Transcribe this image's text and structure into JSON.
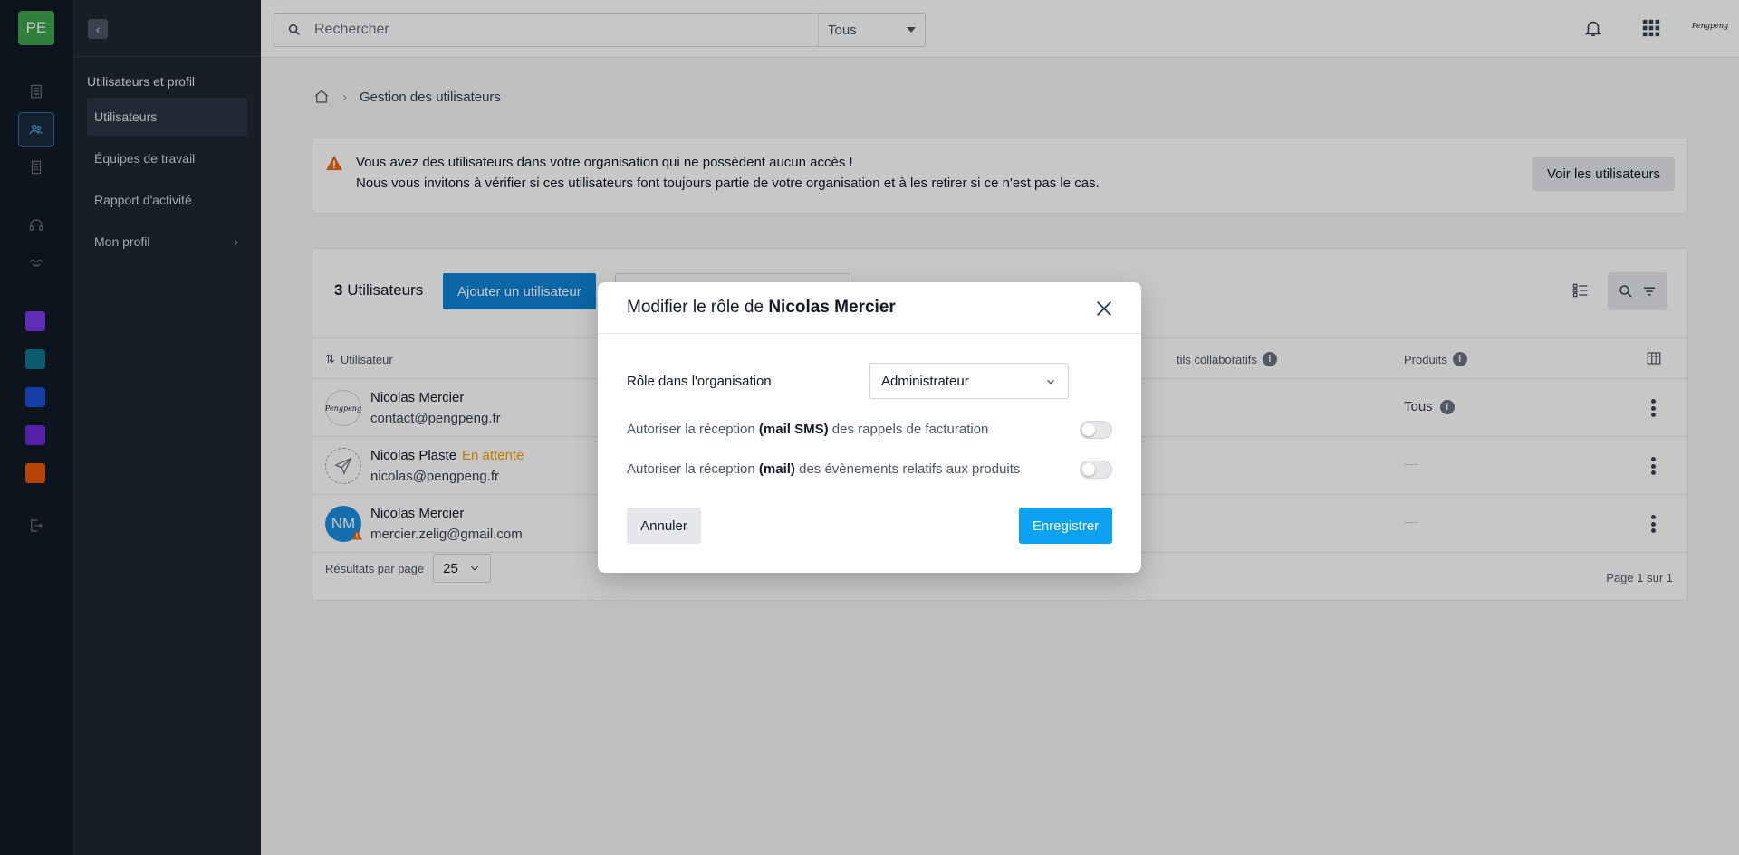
{
  "rail": {
    "avatar_initials": "PE",
    "icons": [
      "calculator-icon",
      "users-icon",
      "building-icon",
      "headset-icon",
      "handshake-icon"
    ],
    "apps": [
      {
        "name": "app-k-icon",
        "color": "#7c3aed"
      },
      {
        "name": "app-play-icon",
        "color": "#0e7490"
      },
      {
        "name": "app-cube-icon",
        "color": "#1d4ed8"
      },
      {
        "name": "app-square-icon",
        "color": "#6d28d9"
      },
      {
        "name": "app-doc-icon",
        "color": "#ea580c"
      }
    ],
    "logout_icon": "logout-icon"
  },
  "sidebar": {
    "section_title": "Utilisateurs et profil",
    "items": [
      {
        "label": "Utilisateurs",
        "active": true
      },
      {
        "label": "Équipes de travail",
        "active": false
      },
      {
        "label": "Rapport d'activité",
        "active": false
      },
      {
        "label": "Mon profil",
        "active": false
      }
    ]
  },
  "topbar": {
    "search_placeholder": "Rechercher",
    "scope": "Tous",
    "brand": "Pengpeng"
  },
  "breadcrumb": {
    "current": "Gestion des utilisateurs"
  },
  "alert": {
    "line1": "Vous avez des utilisateurs dans votre organisation qui ne possèdent aucun accès !",
    "line2": "Nous vous invitons à vérifier si ces utilisateurs font toujours partie de votre organisation et à les retirer si ce n'est pas le cas.",
    "button": "Voir les utilisateurs"
  },
  "users_card": {
    "count": "3",
    "count_label": "Utilisateurs",
    "add_button": "Ajouter un utilisateur",
    "columns": {
      "user": "Utilisateur",
      "tools": "tils collaboratifs",
      "products": "Produits"
    },
    "rows": [
      {
        "name": "Nicolas Mercier",
        "status": "",
        "email": "contact@pengpeng.fr",
        "products": "Tous",
        "avatar": "Pengpeng"
      },
      {
        "name": "Nicolas Plaste",
        "status": "En attente",
        "email": "nicolas@pengpeng.fr",
        "products": "",
        "avatar": ""
      },
      {
        "name": "Nicolas Mercier",
        "status": "",
        "email": "mercier.zelig@gmail.com",
        "products": "",
        "avatar": "NM"
      }
    ],
    "per_page_label": "Résultats par page",
    "per_page_value": "25",
    "pagination": "Page 1 sur 1"
  },
  "modal": {
    "title_prefix": "Modifier le rôle de",
    "title_name": "Nicolas Mercier",
    "role_label": "Rôle dans l'organisation",
    "role_value": "Administrateur",
    "option1": {
      "pre": "Autoriser la réception",
      "bold": "(mail SMS)",
      "post": "des rappels de facturation",
      "enabled": false
    },
    "option2": {
      "pre": "Autoriser la réception",
      "bold": "(mail)",
      "post": "des évènements relatifs aux produits",
      "enabled": false
    },
    "cancel": "Annuler",
    "save": "Enregistrer"
  }
}
